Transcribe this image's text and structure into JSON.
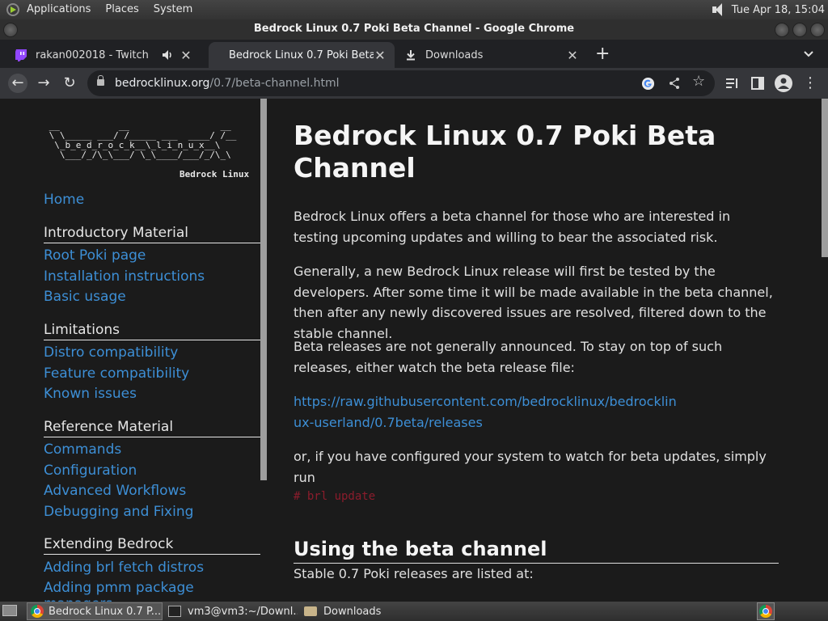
{
  "top_panel": {
    "menus": [
      "Applications",
      "Places",
      "System"
    ],
    "clock": "Tue Apr 18, 15:04"
  },
  "window": {
    "title": "Bedrock Linux 0.7 Poki Beta Channel - Google Chrome"
  },
  "tabs": [
    {
      "title": "rakan002018 - Twitch",
      "icon": "twitch-icon"
    },
    {
      "title": "Bedrock Linux 0.7 Poki Beta C",
      "icon": "none"
    },
    {
      "title": "Downloads",
      "icon": "download-icon"
    }
  ],
  "address_bar": {
    "host": "bedrocklinux.org",
    "path": "/0.7/beta-channel.html"
  },
  "sidebar": {
    "logo_art": " __           __                 __\n \\ \\_____ ___/ /_____ ___  ____/ /__\n  \\_b_e_d_r_o_c_k__\\_l_i_n_u_x__\\\n   \\___/_/\\_\\___/ \\_\\____/___/_/\\_\\",
    "logo_caption": "Bedrock Linux",
    "home": "Home",
    "sections": [
      {
        "heading": "Introductory Material",
        "links": [
          "Root Poki page",
          "Installation instructions",
          "Basic usage"
        ]
      },
      {
        "heading": "Limitations",
        "links": [
          "Distro compatibility",
          "Feature compatibility",
          "Known issues"
        ]
      },
      {
        "heading": "Reference Material",
        "links": [
          "Commands",
          "Configuration",
          "Advanced Workflows",
          "Debugging and Fixing"
        ]
      },
      {
        "heading": "Extending Bedrock",
        "links": [
          "Adding brl fetch distros",
          "Adding pmm package managers"
        ]
      }
    ]
  },
  "content": {
    "title": "Bedrock Linux 0.7 Poki Beta Channel",
    "paragraphs": [
      "Bedrock Linux offers a beta channel for those who are interested in testing upcoming updates and willing to bear the associated risk.",
      "Generally, a new Bedrock Linux release will first be tested by the developers. After some time it will be made available in the beta channel, then after any newly discovered issues are resolved, filtered down to the stable channel.",
      "Beta releases are not generally announced. To stay on top of such releases, either watch the beta release file:",
      "or, if you have configured your system to watch for beta updates, simply run"
    ],
    "link": "https://raw.githubusercontent.com/bedrocklinux/bedrocklinux-userland/0.7beta/releases",
    "code": "# brl update",
    "section_heading": "Using the beta channel",
    "last_paragraph": "Stable 0.7 Poki releases are listed at:"
  },
  "taskbar": {
    "items": [
      {
        "label": "Bedrock Linux 0.7 P...",
        "icon": "chrome-icon"
      },
      {
        "label": "vm3@vm3:~/Downl...",
        "icon": "terminal-icon"
      },
      {
        "label": "Downloads",
        "icon": "folder-icon"
      }
    ]
  }
}
